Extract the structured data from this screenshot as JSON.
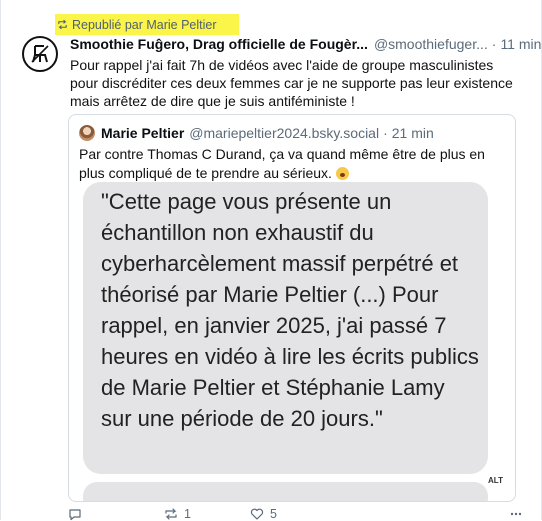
{
  "repost": {
    "icon": "repost-icon",
    "text": "Republié par Marie Peltier",
    "highlight_color": "#fbf54a"
  },
  "post": {
    "avatar_icon": "chair-logo-avatar",
    "author": "Smoothie Fuĝero, Drag officielle de Fougèr...",
    "handle": "@smoothiefuger...",
    "separator": "·",
    "time": "11 min",
    "text": "Pour rappel j'ai fait 7h de vidéos avec l'aide de groupe masculinistes pour discréditer ces deux femmes car je ne supporte pas leur existence mais arrêtez de dire que je suis antiféministe !"
  },
  "quote": {
    "author": "Marie Peltier",
    "handle": "@mariepeltier2024.bsky.social",
    "separator": "·",
    "time": "21 min",
    "text": "Par contre Thomas C Durand, ça va quand même être de plus en plus compliqué de te prendre au sérieux.",
    "emoji": "pouting-face-emoji",
    "image_text": "\"Cette page vous présente un échantillon non exhaustif du cyberharcèlement massif perpétré et théorisé par Marie Peltier (...) Pour rappel, en janvier 2025, j'ai passé 7 heures en vidéo à lire les écrits publics de Marie Peltier et Stéphanie Lamy sur une période de 20 jours.\"",
    "alt_label": "ALT"
  },
  "actions": {
    "reply_icon": "reply-icon",
    "repost_icon": "repost-icon",
    "repost_count": "1",
    "like_icon": "heart-icon",
    "like_count": "5",
    "more_icon": "more-icon"
  }
}
